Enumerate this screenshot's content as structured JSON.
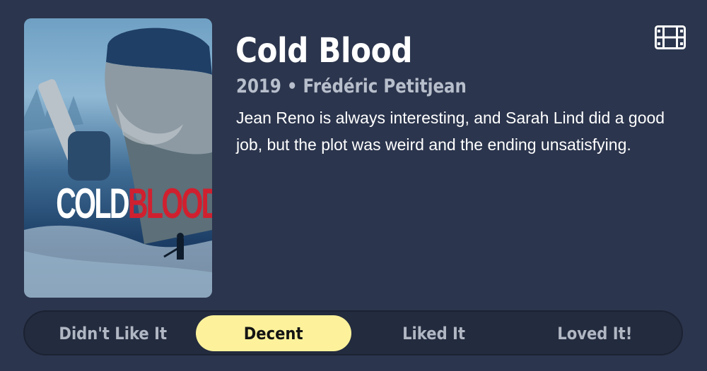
{
  "movie": {
    "poster_title_part1": "COLD",
    "poster_title_part2": "BLOOD",
    "title": "Cold Blood",
    "subtitle": "2019 • Frédéric Petitjean",
    "review": "Jean Reno is always interesting, and Sarah Lind did a good job, but the plot was weird and the ending unsatisfying.",
    "type_icon": "film-icon"
  },
  "rating": {
    "options": [
      "Didn't Like It",
      "Decent",
      "Liked It",
      "Loved It!"
    ],
    "selected": "Decent",
    "selected_color": "#fdf29b"
  },
  "colors": {
    "background": "#2b354d",
    "poster_accent": "#d0202f"
  }
}
